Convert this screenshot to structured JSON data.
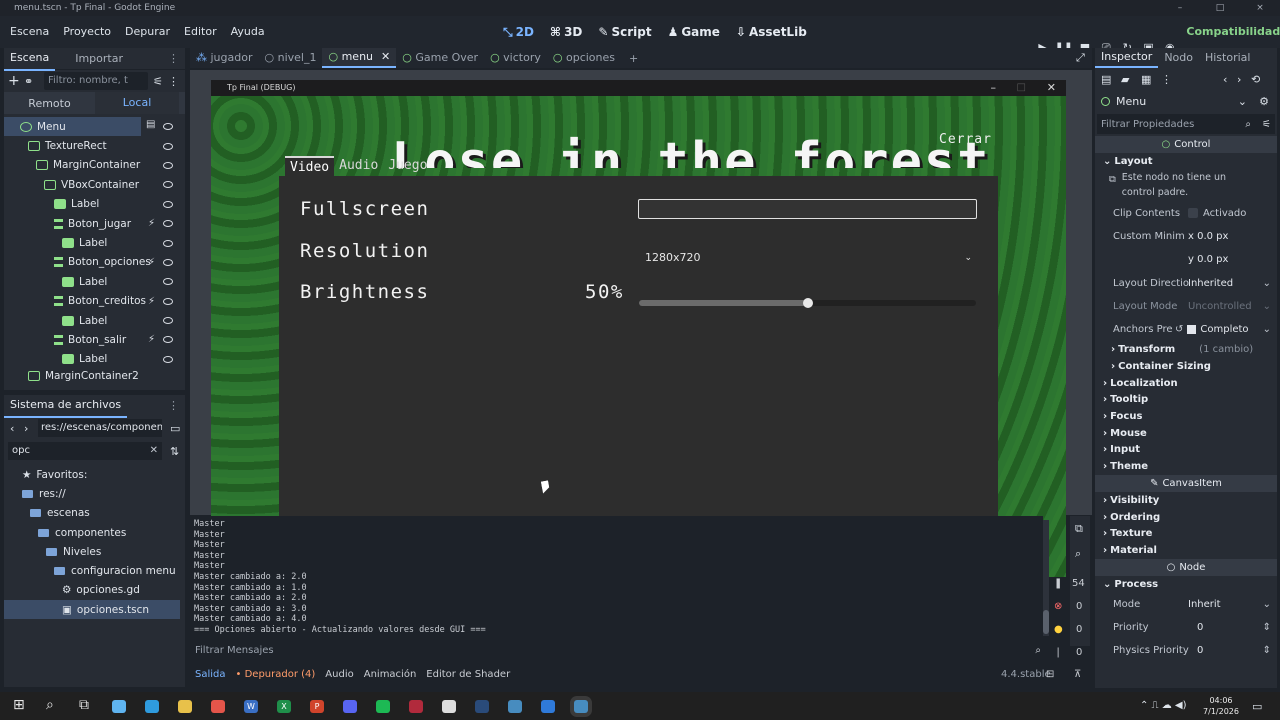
{
  "window": {
    "title": "menu.tscn - Tp Final - Godot Engine"
  },
  "menus": [
    "Escena",
    "Proyecto",
    "Depurar",
    "Editor",
    "Ayuda"
  ],
  "modes": [
    {
      "icon": "2d-icon",
      "label": "2D"
    },
    {
      "icon": "3d-icon",
      "label": "3D"
    },
    {
      "icon": "script-icon",
      "label": "Script"
    },
    {
      "icon": "game-icon",
      "label": "Game"
    },
    {
      "icon": "assetlib-icon",
      "label": "AssetLib"
    }
  ],
  "renderer": "Compatibilidad",
  "scene_panel": {
    "tabs": [
      "Escena",
      "Importar"
    ],
    "filter_placeholder": "Filtro: nombre, t",
    "subtabs": [
      "Remoto",
      "Local"
    ],
    "tree": [
      {
        "label": "Menu",
        "depth": 0,
        "icon": "control-icon"
      },
      {
        "label": "TextureRect",
        "depth": 1,
        "icon": "texturerect-icon"
      },
      {
        "label": "MarginContainer",
        "depth": 2,
        "icon": "margincontainer-icon"
      },
      {
        "label": "VBoxContainer",
        "depth": 3,
        "icon": "vboxcontainer-icon"
      },
      {
        "label": "Label",
        "depth": 4,
        "icon": "label-icon"
      },
      {
        "label": "Boton_jugar",
        "depth": 4,
        "icon": "button-icon"
      },
      {
        "label": "Label",
        "depth": 5,
        "icon": "label-icon"
      },
      {
        "label": "Boton_opciones",
        "depth": 4,
        "icon": "button-icon"
      },
      {
        "label": "Label",
        "depth": 5,
        "icon": "label-icon"
      },
      {
        "label": "Boton_creditos",
        "depth": 4,
        "icon": "button-icon"
      },
      {
        "label": "Label",
        "depth": 5,
        "icon": "label-icon"
      },
      {
        "label": "Boton_salir",
        "depth": 4,
        "icon": "button-icon"
      },
      {
        "label": "Label",
        "depth": 5,
        "icon": "label-icon"
      },
      {
        "label": "MarginContainer2",
        "depth": 1,
        "icon": "margincontainer-icon"
      }
    ]
  },
  "filesystem": {
    "title": "Sistema de archivos",
    "path": "res://escenas/component",
    "search": "opc",
    "items": [
      {
        "label": "Favoritos:",
        "depth": 0,
        "icon": "star-icon"
      },
      {
        "label": "res://",
        "depth": 0,
        "icon": "folder-icon"
      },
      {
        "label": "escenas",
        "depth": 1,
        "icon": "folder-icon"
      },
      {
        "label": "componentes",
        "depth": 2,
        "icon": "folder-icon"
      },
      {
        "label": "Niveles",
        "depth": 3,
        "icon": "folder-icon"
      },
      {
        "label": "configuracion menu",
        "depth": 4,
        "icon": "folder-icon"
      },
      {
        "label": "opciones.gd",
        "depth": 5,
        "icon": "gear-icon"
      },
      {
        "label": "opciones.tscn",
        "depth": 5,
        "icon": "scene-icon"
      }
    ]
  },
  "scene_tabs": [
    "jugador",
    "nivel_1",
    "menu",
    "Game Over",
    "victory",
    "opciones"
  ],
  "game_window": {
    "title": "Tp Final (DEBUG)",
    "game_title": "Lose in the forest",
    "close_label": "Cerrar",
    "tabs": [
      "Video",
      "Audio",
      "Juego"
    ],
    "options": {
      "fullscreen_label": "Fullscreen",
      "resolution_label": "Resolution",
      "resolution_value": "1280x720",
      "brightness_label": "Brightness",
      "brightness_value": "50%",
      "brightness_fraction": 0.5
    }
  },
  "console": {
    "lines": [
      "Master",
      "Master",
      "Master",
      "Master",
      "Master",
      "Master cambiado a: 2.0",
      "Master cambiado a: 1.0",
      "Master cambiado a: 2.0",
      "Master cambiado a: 3.0",
      "Master cambiado a: 4.0",
      "=== Opciones abierto - Actualizando valores desde GUI ==="
    ],
    "filter_placeholder": "Filtrar Mensajes",
    "counts": [
      "54",
      "0",
      "0",
      "0"
    ]
  },
  "bottom_tabs": [
    "Salida",
    "Depurador (4)",
    "Audio",
    "Animación",
    "Editor de Shader"
  ],
  "version": "4.4.stable",
  "inspector": {
    "tabs": [
      "Inspector",
      "Nodo",
      "Historial"
    ],
    "node": "Menu",
    "filter_placeholder": "Filtrar Propiedades",
    "class_header": "Control",
    "layout_section": "Layout",
    "warning": "Este nodo no tiene un control padre.",
    "props": [
      {
        "label": "Clip Contents",
        "value": "Activado"
      },
      {
        "label": "Custom Minim",
        "value": "x 0.0 px"
      },
      {
        "label": "",
        "value": "y 0.0 px"
      },
      {
        "label": "Layout Directio",
        "value": "Inherited"
      },
      {
        "label": "Layout Mode",
        "value": "Uncontrolled"
      },
      {
        "label": "Anchors Pre",
        "value": "Completo"
      }
    ],
    "subsections": [
      {
        "label": "Transform",
        "note": "(1 cambio)"
      },
      {
        "label": "Container Sizing",
        "note": ""
      }
    ],
    "sections": [
      "Localization",
      "Tooltip",
      "Focus",
      "Mouse",
      "Input",
      "Theme"
    ],
    "canvas_header": "CanvasItem",
    "canvas_sections": [
      "Visibility",
      "Ordering",
      "Texture",
      "Material"
    ],
    "node_header": "Node",
    "process_section": "Process",
    "process_props": [
      {
        "label": "Mode",
        "value": "Inherit"
      },
      {
        "label": "Priority",
        "value": "0"
      },
      {
        "label": "Physics Priority",
        "value": "0"
      }
    ]
  },
  "taskbar": {
    "time": "04:06",
    "date": "7/1/2026",
    "apps": [
      "start-icon",
      "search-icon",
      "taskview-icon",
      "copilot-icon",
      "edge-icon",
      "explorer-icon",
      "chrome-icon",
      "word-icon",
      "excel-icon",
      "powerpoint-icon",
      "discord-icon",
      "spotify-icon",
      "winrar-icon",
      "github-icon",
      "steam-icon",
      "godot-icon",
      "maps-icon",
      "godot-debug-icon"
    ]
  },
  "colors": {
    "accent": "#7ab4ff",
    "node_green": "#8fe08a",
    "renderer": "#88d28a"
  }
}
